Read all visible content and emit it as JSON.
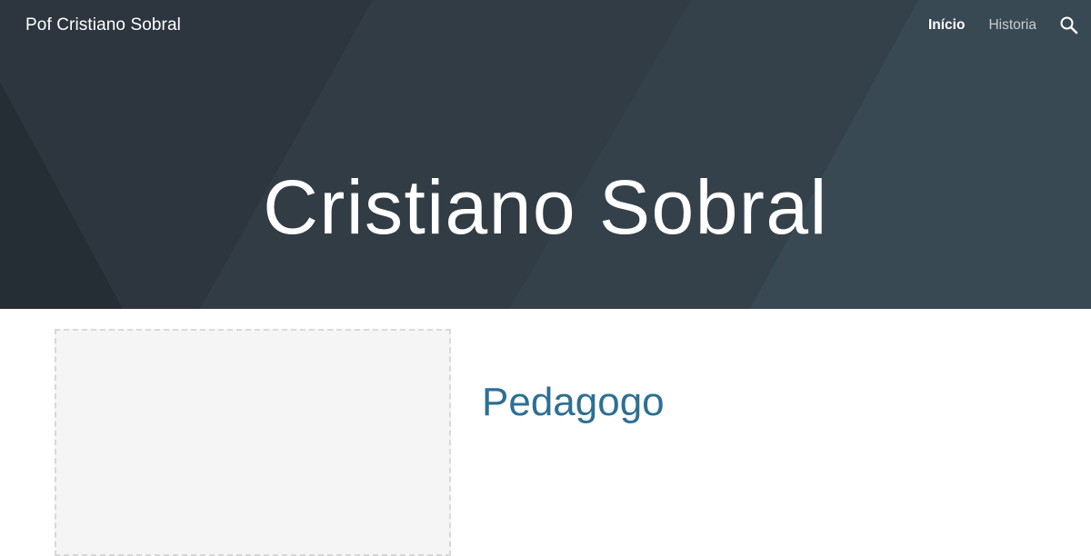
{
  "header": {
    "site_title": "Pof Cristiano Sobral",
    "nav": [
      {
        "label": "Início",
        "active": true
      },
      {
        "label": "Historia",
        "active": false
      }
    ],
    "search_icon": "search-icon"
  },
  "hero": {
    "title": "Cristiano Sobral"
  },
  "main": {
    "image_placeholder": "image-placeholder",
    "subtitle": "Pedagogo"
  },
  "colors": {
    "hero_background": "#313c45",
    "hero_text": "#ffffff",
    "subtitle": "#2e6f93",
    "placeholder_background": "#f5f5f5",
    "placeholder_border": "#d8d8d8"
  }
}
